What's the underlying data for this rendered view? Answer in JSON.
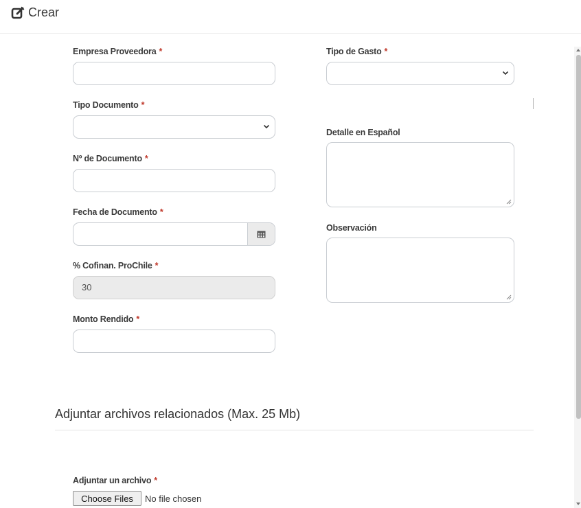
{
  "header": {
    "title": "Crear",
    "icon": "edit-square-icon"
  },
  "form": {
    "required_mark": "*",
    "empresa": {
      "label": "Empresa Proveedora",
      "value": ""
    },
    "tipo_gasto": {
      "label": "Tipo de Gasto",
      "value": ""
    },
    "tipo_documento": {
      "label": "Tipo Documento",
      "value": ""
    },
    "detalle": {
      "label": "Detalle en Español",
      "value": ""
    },
    "numero_documento": {
      "label": "Nº de Documento",
      "value": ""
    },
    "fecha": {
      "label": "Fecha de Documento",
      "value": "",
      "icon": "calendar-icon"
    },
    "observacion": {
      "label": "Observación",
      "value": ""
    },
    "cofinan": {
      "label": "% Cofinan. ProChile",
      "value": "30"
    },
    "monto": {
      "label": "Monto Rendido",
      "value": ""
    }
  },
  "attachments": {
    "title": "Adjuntar archivos relacionados (Max. 25 Mb)",
    "file_label": "Adjuntar un archivo",
    "button_label": "Choose Files",
    "status": "No file chosen"
  }
}
